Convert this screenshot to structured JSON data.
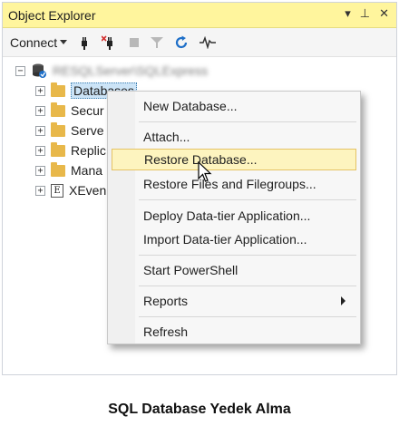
{
  "window": {
    "title": "Object Explorer",
    "controls": [
      "▾",
      "⊥",
      "✕"
    ]
  },
  "toolbar": {
    "connect_label": "Connect",
    "icons": [
      "connect-icon",
      "disconnect-icon",
      "stop-icon",
      "filter-icon",
      "refresh-icon",
      "activity-icon"
    ]
  },
  "tree": {
    "server_label": "RESQLServer\\SQLExpress",
    "items": [
      {
        "label": "Databases",
        "icon": "folder-icon",
        "selected": true
      },
      {
        "label": "Secur",
        "icon": "folder-icon"
      },
      {
        "label": "Serve",
        "icon": "folder-icon"
      },
      {
        "label": "Replic",
        "icon": "folder-icon"
      },
      {
        "label": "Mana",
        "icon": "folder-icon"
      },
      {
        "label": "XEven",
        "icon": "xevent-icon"
      }
    ]
  },
  "context_menu": {
    "items": [
      {
        "label": "New Database..."
      },
      {
        "label": "Attach..."
      },
      {
        "label": "Restore Database...",
        "highlighted": true
      },
      {
        "label": "Restore Files and Filegroups..."
      },
      {
        "label": "Deploy Data-tier Application..."
      },
      {
        "label": "Import Data-tier Application..."
      },
      {
        "label": "Start PowerShell"
      },
      {
        "label": "Reports",
        "submenu": true
      },
      {
        "label": "Refresh"
      }
    ]
  },
  "caption": "SQL Database Yedek Alma",
  "colors": {
    "title_bg": "#fff59d",
    "highlight_bg": "#fdf4bf",
    "selection_bg": "#cce4f7"
  }
}
